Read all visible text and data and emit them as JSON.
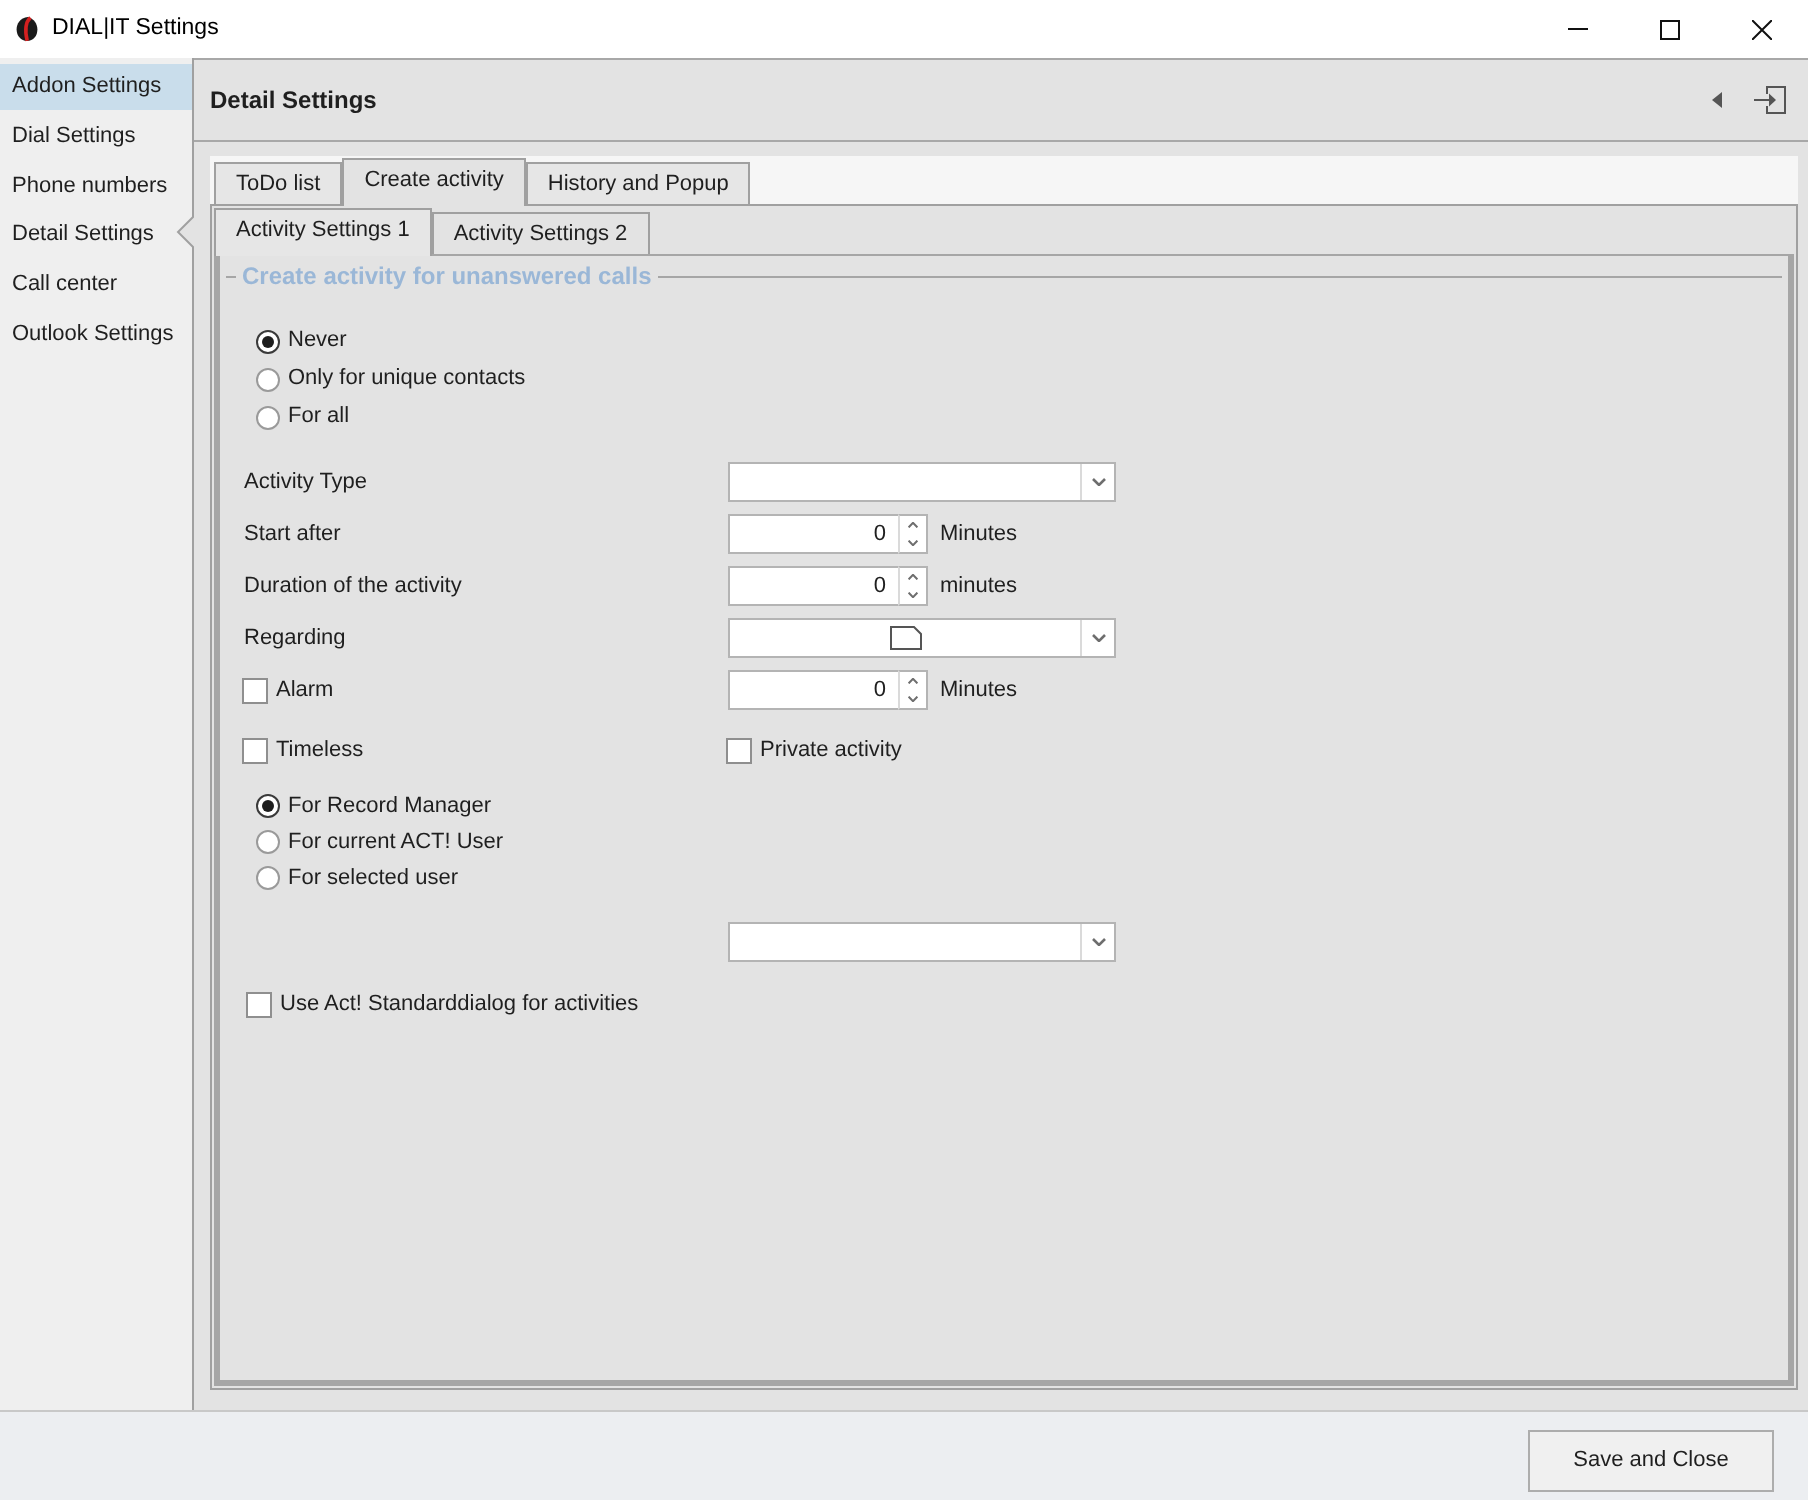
{
  "window": {
    "title": "DIAL|IT Settings"
  },
  "sidebar": {
    "items": [
      {
        "label": "Addon Settings",
        "highlighted": true,
        "selected": false
      },
      {
        "label": "Dial Settings",
        "highlighted": false,
        "selected": false
      },
      {
        "label": "Phone numbers",
        "highlighted": false,
        "selected": false
      },
      {
        "label": "Detail Settings",
        "highlighted": false,
        "selected": true
      },
      {
        "label": "Call center",
        "highlighted": false,
        "selected": false
      },
      {
        "label": "Outlook Settings",
        "highlighted": false,
        "selected": false
      }
    ]
  },
  "panel": {
    "title": "Detail Settings"
  },
  "tabs": [
    {
      "label": "ToDo list",
      "selected": false
    },
    {
      "label": "Create activity",
      "selected": true
    },
    {
      "label": "History and Popup",
      "selected": false
    }
  ],
  "subtabs": [
    {
      "label": "Activity Settings 1",
      "selected": true
    },
    {
      "label": "Activity Settings 2",
      "selected": false
    }
  ],
  "group": {
    "title": "Create activity for unanswered calls"
  },
  "unanswered_options": [
    {
      "label": "Never",
      "selected": true
    },
    {
      "label": "Only for unique contacts",
      "selected": false
    },
    {
      "label": "For all",
      "selected": false
    }
  ],
  "fields": [
    {
      "kind": "combo",
      "label": "Activity Type"
    },
    {
      "kind": "spin",
      "label": "Start after",
      "value": "0",
      "unit": "Minutes"
    },
    {
      "kind": "spin",
      "label": "Duration of the activity",
      "value": "0",
      "unit": "minutes"
    },
    {
      "kind": "doccombo",
      "label": "Regarding"
    },
    {
      "kind": "checkspin",
      "label": "Alarm",
      "checked": false,
      "value": "0",
      "unit": "Minutes"
    }
  ],
  "options": [
    {
      "label": "Timeless",
      "checked": false
    },
    {
      "label": "Private activity",
      "checked": false
    }
  ],
  "owner_options": [
    {
      "label": "For Record Manager",
      "selected": true
    },
    {
      "label": "For current ACT! User",
      "selected": false
    },
    {
      "label": "For selected user",
      "selected": false
    }
  ],
  "standard_dialog": {
    "label": "Use Act! Standarddialog for activities",
    "checked": false
  },
  "footer": {
    "buttons": [
      "Save and Close"
    ]
  }
}
